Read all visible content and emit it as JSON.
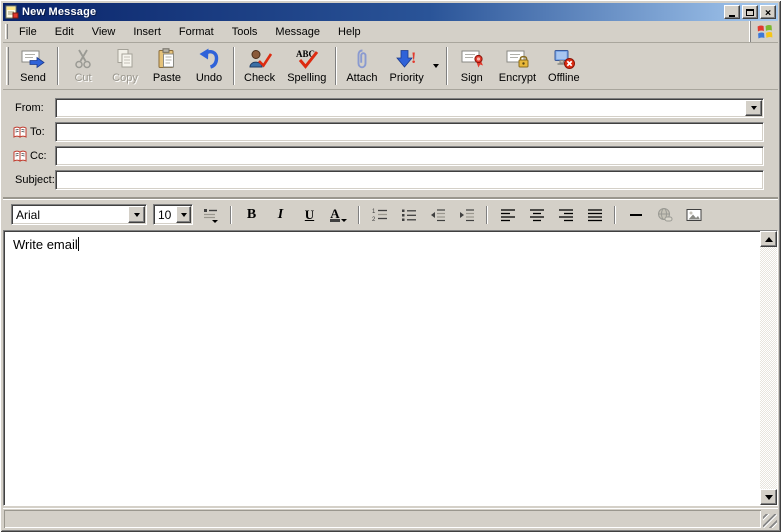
{
  "window": {
    "title": "New Message"
  },
  "menu": {
    "items": [
      "File",
      "Edit",
      "View",
      "Insert",
      "Format",
      "Tools",
      "Message",
      "Help"
    ]
  },
  "toolbar": {
    "buttons": [
      {
        "label": "Send",
        "disabled": false
      },
      {
        "label": "Cut",
        "disabled": true
      },
      {
        "label": "Copy",
        "disabled": true
      },
      {
        "label": "Paste",
        "disabled": false
      },
      {
        "label": "Undo",
        "disabled": false
      },
      {
        "label": "Check",
        "disabled": false
      },
      {
        "label": "Spelling",
        "disabled": false
      },
      {
        "label": "Attach",
        "disabled": false
      },
      {
        "label": "Priority",
        "disabled": false
      },
      {
        "label": "Sign",
        "disabled": false
      },
      {
        "label": "Encrypt",
        "disabled": false
      },
      {
        "label": "Offline",
        "disabled": false
      }
    ]
  },
  "headers": {
    "from_label": "From:",
    "from_value": "",
    "to_label": "To:",
    "to_value": "",
    "cc_label": "Cc:",
    "cc_value": "",
    "subject_label": "Subject:",
    "subject_value": ""
  },
  "format_bar": {
    "font_family": "Arial",
    "font_size": "10"
  },
  "body": {
    "text": "Write email"
  },
  "colors": {
    "chrome": "#d4d0c8",
    "titlebar_start": "#0a246a",
    "titlebar_end": "#a6caf0",
    "title_text": "#ffffff",
    "disabled_text": "#9a978e",
    "accent_blue": "#2f62d9",
    "alert_red": "#dd2b10",
    "gold": "#e8b83a"
  }
}
